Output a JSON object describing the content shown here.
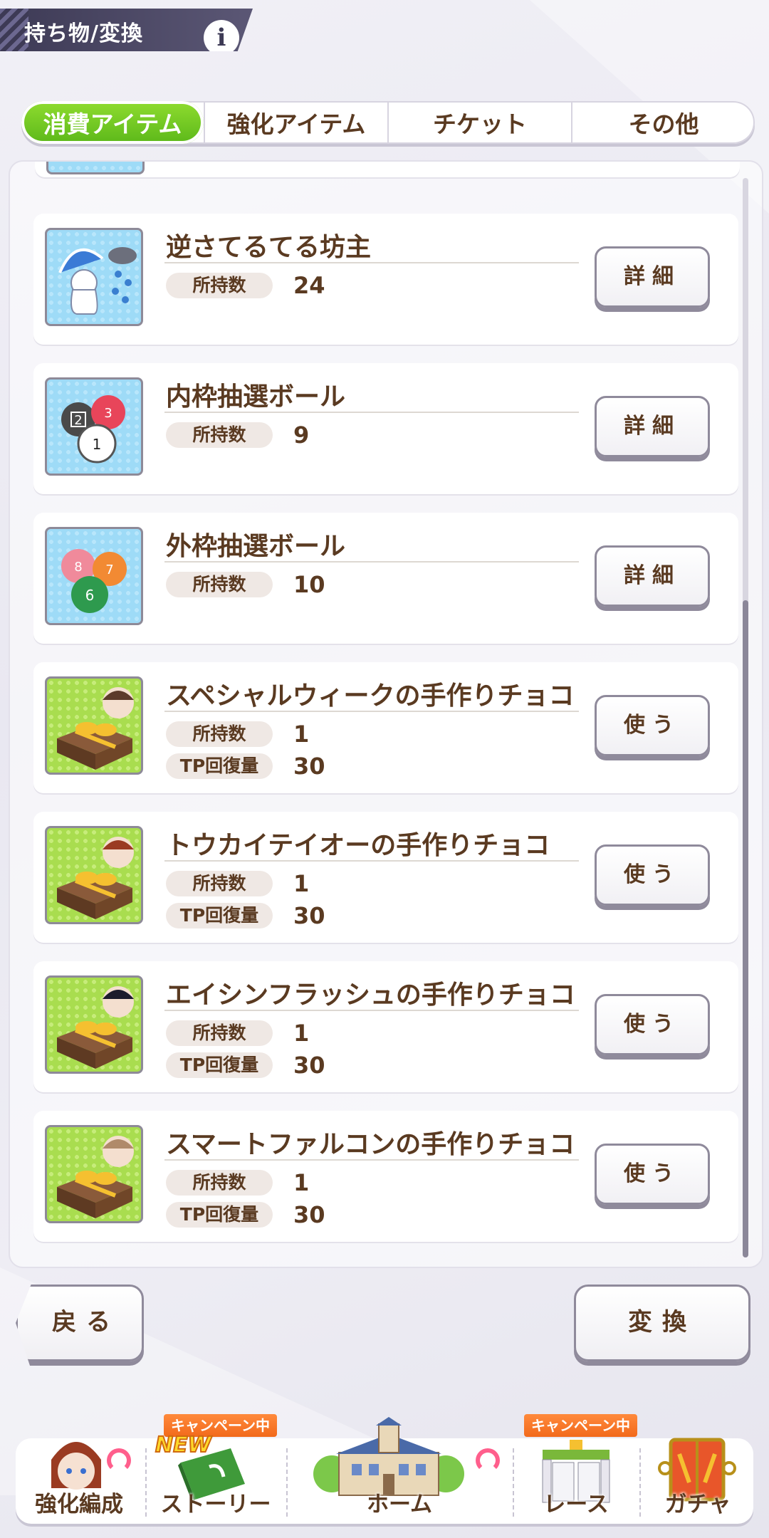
{
  "header": {
    "title": "持ち物/変換",
    "info_icon": "i"
  },
  "tabs": [
    {
      "label": "消費アイテム",
      "active": true
    },
    {
      "label": "強化アイテム",
      "active": false
    },
    {
      "label": "チケット",
      "active": false
    },
    {
      "label": "その他",
      "active": false
    }
  ],
  "items": [
    {
      "name": "逆さてるてる坊主",
      "owned_label": "所持数",
      "owned": "24",
      "button": "詳細",
      "icon": "upside-down-teru-teru-bozu-icon"
    },
    {
      "name": "内枠抽選ボール",
      "owned_label": "所持数",
      "owned": "9",
      "button": "詳細",
      "icon": "inner-gate-lottery-ball-icon"
    },
    {
      "name": "外枠抽選ボール",
      "owned_label": "所持数",
      "owned": "10",
      "button": "詳細",
      "icon": "outer-gate-lottery-ball-icon"
    },
    {
      "name": "スペシャルウィークの手作りチョコ",
      "owned_label": "所持数",
      "owned": "1",
      "tp_label": "TP回復量",
      "tp": "30",
      "button": "使う",
      "icon": "chocolate-gift-icon"
    },
    {
      "name": "トウカイテイオーの手作りチョコ",
      "owned_label": "所持数",
      "owned": "1",
      "tp_label": "TP回復量",
      "tp": "30",
      "button": "使う",
      "icon": "chocolate-gift-icon"
    },
    {
      "name": "エイシンフラッシュの手作りチョコ",
      "owned_label": "所持数",
      "owned": "1",
      "tp_label": "TP回復量",
      "tp": "30",
      "button": "使う",
      "icon": "chocolate-gift-icon"
    },
    {
      "name": "スマートファルコンの手作りチョコ",
      "owned_label": "所持数",
      "owned": "1",
      "tp_label": "TP回復量",
      "tp": "30",
      "button": "使う",
      "icon": "chocolate-gift-icon"
    }
  ],
  "footer": {
    "back_label": "戻る",
    "convert_label": "変換"
  },
  "nav": [
    {
      "label": "強化編成",
      "icon": "character-portrait-icon"
    },
    {
      "label": "ストーリー",
      "icon": "story-book-icon",
      "badge": "キャンペーン中",
      "new": "NEW"
    },
    {
      "label": "ホーム",
      "icon": "school-building-icon"
    },
    {
      "label": "レース",
      "icon": "race-gate-icon",
      "badge": "キャンペーン中"
    },
    {
      "label": "ガチャ",
      "icon": "gacha-door-icon"
    }
  ],
  "colors": {
    "accent_green": "#6cc41f",
    "text_brown": "#5a3a21",
    "badge_orange": "#f26a1b"
  }
}
